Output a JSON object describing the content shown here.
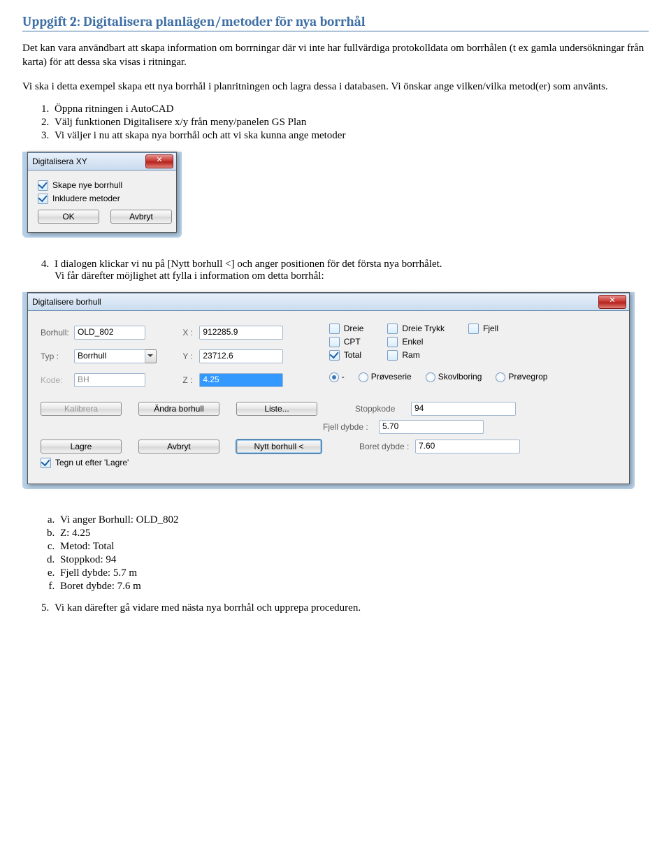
{
  "heading": "Uppgift 2: Digitalisera planlägen/metoder för nya borrhål",
  "p1": "Det kan vara användbart att skapa information om borrningar där vi inte har fullvärdiga protokolldata om borrhålen (t ex gamla undersökningar från karta) för att dessa ska visas i ritningar.",
  "p2": "Vi ska i detta exempel skapa ett nya borrhål i planritningen och lagra dessa i databasen. Vi önskar ange vilken/vilka metod(er) som använts.",
  "list1": [
    "Öppna ritningen i AutoCAD",
    "Välj funktionen Digitalisere x/y från meny/panelen GS Plan",
    "Vi väljer i nu att skapa nya borrhål och att vi ska kunna ange metoder"
  ],
  "dlg1": {
    "title": "Digitalisera XY",
    "chk1": "Skape nye borrhull",
    "chk2": "Inkludere metoder",
    "ok": "OK",
    "cancel": "Avbryt"
  },
  "item4_a": "I dialogen klickar vi nu på [Nytt borhull <] och anger positionen för det första nya borrhålet.",
  "item4_b": "Vi får därefter möjlighet att fylla i information om detta borrhål:",
  "dlg2": {
    "title": "Digitalisere borhull",
    "borhull_lbl": "Borhull:",
    "borhull": "OLD_802",
    "typ_lbl": "Typ :",
    "typ": "Borrhull",
    "kode_lbl": "Kode:",
    "kode": "BH",
    "x_lbl": "X :",
    "x": "912285.9",
    "y_lbl": "Y :",
    "y": "23712.6",
    "z_lbl": "Z :",
    "z": "4.25",
    "m_dreie": "Dreie",
    "m_cpt": "CPT",
    "m_total": "Total",
    "m_dreietrykk": "Dreie Trykk",
    "m_enkel": "Enkel",
    "m_ram": "Ram",
    "m_fjell": "Fjell",
    "r_dash": "-",
    "r_prove": "Prøveserie",
    "r_skovl": "Skovlboring",
    "r_grop": "Prøvegrop",
    "kal": "Kalibrera",
    "andra": "Ändra borhull",
    "liste": "Liste...",
    "lagre": "Lagre",
    "avbryt": "Avbryt",
    "nytt": "Nytt borhull <",
    "tegn": "Tegn ut efter 'Lagre'",
    "stopp_lbl": "Stoppkode",
    "stopp": "94",
    "fjelld_lbl": "Fjell dybde :",
    "fjelld": "5.70",
    "boretd_lbl": "Boret dybde :",
    "boretd": "7.60"
  },
  "sublist": [
    "Vi anger Borhull: OLD_802",
    "Z: 4.25",
    "Metod: Total",
    "Stoppkod: 94",
    "Fjell dybde: 5.7 m",
    "Boret dybde: 7.6 m"
  ],
  "item5": "Vi kan därefter gå vidare med nästa nya borrhål och upprepa proceduren."
}
